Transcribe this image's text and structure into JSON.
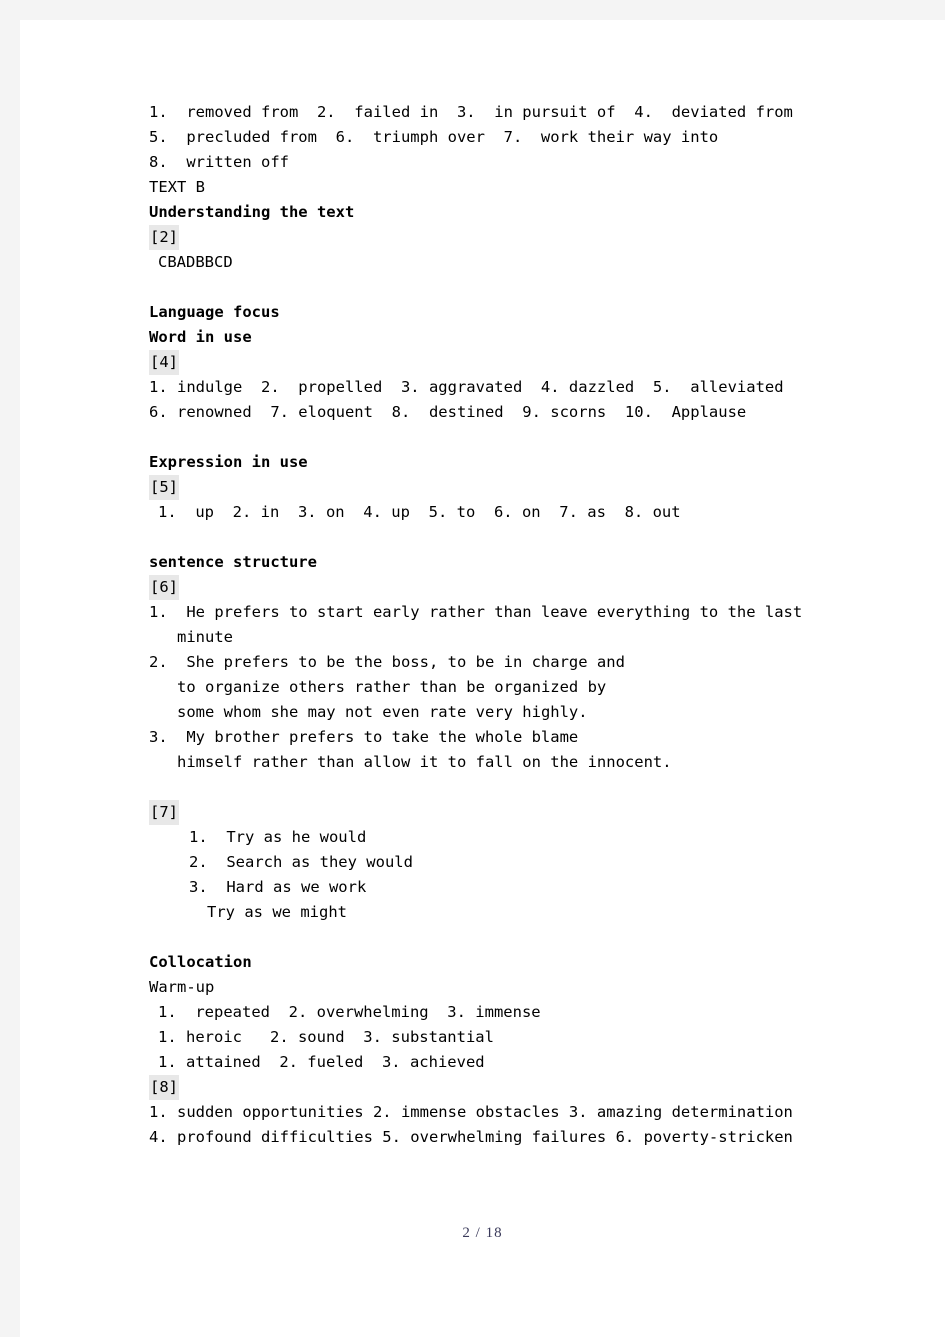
{
  "document": {
    "footer": "2 / 18"
  },
  "blocks": {
    "text_a_answers": {
      "line1": "1.  removed from  2.  failed in  3.  in pursuit of  4.  deviated from",
      "line2": "5.  precluded from  6.  triumph over  7.  work their way into",
      "line3": "8.  written off"
    },
    "text_b_label": "TEXT B",
    "understanding_heading": "Understanding the text",
    "understanding_marker": "[2]",
    "understanding_answer": "CBADBBCD",
    "language_focus_heading": "Language focus",
    "word_in_use_heading": "Word in use",
    "word_in_use_marker": "[4]",
    "word_in_use": {
      "line1": "1. indulge  2.  propelled  3. aggravated  4. dazzled  5.  alleviated",
      "line2": "6. renowned  7. eloquent  8.  destined  9. scorns  10.  Applause"
    },
    "expression_in_use_heading": "Expression in use",
    "expression_in_use_marker": "[5]",
    "expression_in_use": "1.  up  2. in  3. on  4. up  5. to  6. on  7. as  8. out",
    "sentence_structure_heading": "sentence structure",
    "sentence_structure_marker": "[6]",
    "sentence_structure": {
      "item1_a": "1.  He prefers to start early rather than leave everything to the last",
      "item1_b": "minute",
      "item2_a": "2.  She prefers to be the boss, to be in charge and",
      "item2_b": "to organize others rather than be organized by",
      "item2_c": "some whom she may not even rate very highly.",
      "item3_a": "3.  My brother prefers to take the whole blame",
      "item3_b": "himself rather than allow it to fall on the innocent."
    },
    "as_clause_marker": "[7]",
    "as_clause": {
      "item1": "1.  Try as he would",
      "item2": "2.  Search as they would",
      "item3": "3.  Hard as we work",
      "item4": "Try as we might"
    },
    "collocation_heading": "Collocation",
    "warm_up_label": "Warm-up",
    "warm_up": {
      "line1": "1.  repeated  2. overwhelming  3. immense",
      "line2": "1. heroic   2. sound  3. substantial",
      "line3": "1. attained  2. fueled  3. achieved"
    },
    "collocation_marker": "[8]",
    "collocation_answers": {
      "line1": "1.  sudden  opportunities  2.  immense obstacles  3.  amazing determination",
      "line2": "4.  profound  difficulties  5.  overwhelming  failures  6. poverty-stricken"
    }
  }
}
